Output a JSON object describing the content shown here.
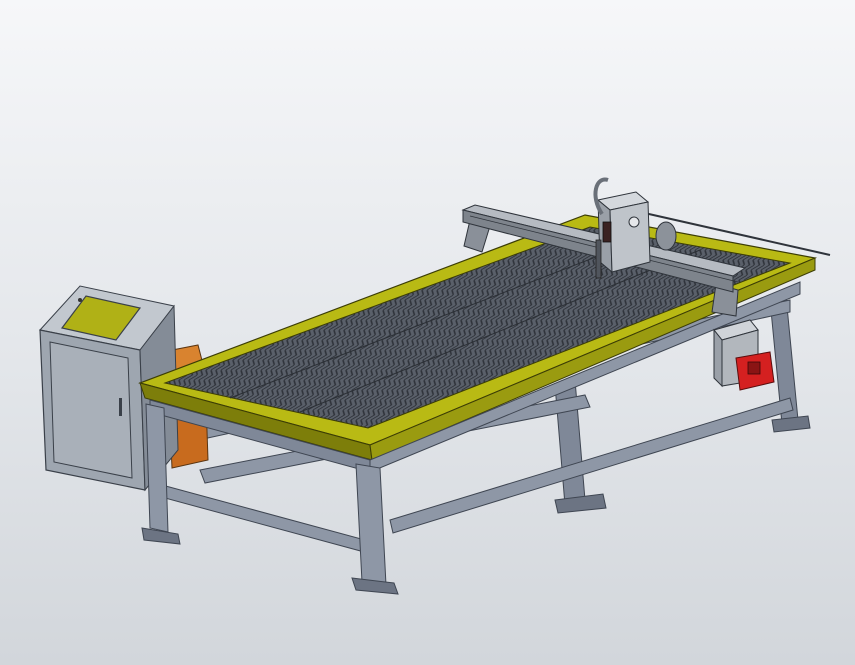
{
  "scene": {
    "subject": "cnc-plasma-cutting-table",
    "colors": {
      "background_top": "#f6f7f9",
      "background_bottom": "#d2d6db",
      "frame_steel": "#8e97a6",
      "frame_steel_dark": "#5f6878",
      "table_rim_yellow": "#b9ba14",
      "table_rim_yellow_dark": "#7d7e0a",
      "slat_grid": "#4a4f58",
      "cabinet_gray": "#a6adb6",
      "cabinet_screen": "#b0b116",
      "side_box_orange": "#c86b1e",
      "motor_red": "#d42020",
      "gantry_gray": "#9aa0a8"
    }
  }
}
